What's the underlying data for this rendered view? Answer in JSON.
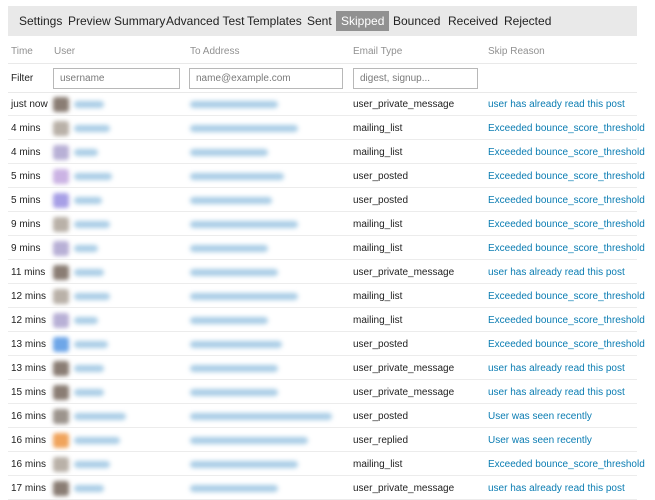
{
  "nav": {
    "items": [
      {
        "label": "Settings",
        "active": false
      },
      {
        "label": "Preview Summary",
        "active": false
      },
      {
        "label": "Advanced Test",
        "active": false
      },
      {
        "label": "Templates",
        "active": false
      },
      {
        "label": "Sent",
        "active": false
      },
      {
        "label": "Skipped",
        "active": true
      },
      {
        "label": "Bounced",
        "active": false
      },
      {
        "label": "Received",
        "active": false
      },
      {
        "label": "Rejected",
        "active": false
      }
    ]
  },
  "table": {
    "headers": {
      "time": "Time",
      "user": "User",
      "to_address": "To Address",
      "email_type": "Email Type",
      "skip_reason": "Skip Reason"
    },
    "filter": {
      "label": "Filter",
      "username_placeholder": "username",
      "address_placeholder": "name@example.com",
      "type_placeholder": "digest, signup..."
    },
    "rows": [
      {
        "time": "just now",
        "email_type": "user_private_message",
        "skip_reason": "user has already read this post",
        "avatar_color": "#8a7d74"
      },
      {
        "time": "4 mins",
        "email_type": "mailing_list",
        "skip_reason": "Exceeded bounce_score_threshold",
        "avatar_color": "#b9b1a8"
      },
      {
        "time": "4 mins",
        "email_type": "mailing_list",
        "skip_reason": "Exceeded bounce_score_threshold",
        "avatar_color": "#b8b0d6"
      },
      {
        "time": "5 mins",
        "email_type": "user_posted",
        "skip_reason": "Exceeded bounce_score_threshold",
        "avatar_color": "#cbb3e4"
      },
      {
        "time": "5 mins",
        "email_type": "user_posted",
        "skip_reason": "Exceeded bounce_score_threshold",
        "avatar_color": "#a79fe6"
      },
      {
        "time": "9 mins",
        "email_type": "mailing_list",
        "skip_reason": "Exceeded bounce_score_threshold",
        "avatar_color": "#b9b1a8"
      },
      {
        "time": "9 mins",
        "email_type": "mailing_list",
        "skip_reason": "Exceeded bounce_score_threshold",
        "avatar_color": "#b8b0d6"
      },
      {
        "time": "11 mins",
        "email_type": "user_private_message",
        "skip_reason": "user has already read this post",
        "avatar_color": "#8a7d74"
      },
      {
        "time": "12 mins",
        "email_type": "mailing_list",
        "skip_reason": "Exceeded bounce_score_threshold",
        "avatar_color": "#b9b1a8"
      },
      {
        "time": "12 mins",
        "email_type": "mailing_list",
        "skip_reason": "Exceeded bounce_score_threshold",
        "avatar_color": "#b8b0d6"
      },
      {
        "time": "13 mins",
        "email_type": "user_posted",
        "skip_reason": "Exceeded bounce_score_threshold",
        "avatar_color": "#6ea6e8"
      },
      {
        "time": "13 mins",
        "email_type": "user_private_message",
        "skip_reason": "user has already read this post",
        "avatar_color": "#8a7d74"
      },
      {
        "time": "15 mins",
        "email_type": "user_private_message",
        "skip_reason": "user has already read this post",
        "avatar_color": "#8a7d74"
      },
      {
        "time": "16 mins",
        "email_type": "user_posted",
        "skip_reason": "User was seen recently",
        "avatar_color": "#9c948d"
      },
      {
        "time": "16 mins",
        "email_type": "user_replied",
        "skip_reason": "User was seen recently",
        "avatar_color": "#f0a45c"
      },
      {
        "time": "16 mins",
        "email_type": "mailing_list",
        "skip_reason": "Exceeded bounce_score_threshold",
        "avatar_color": "#b9b1a8"
      },
      {
        "time": "17 mins",
        "email_type": "user_private_message",
        "skip_reason": "user has already read this post",
        "avatar_color": "#8a7d74"
      }
    ]
  }
}
